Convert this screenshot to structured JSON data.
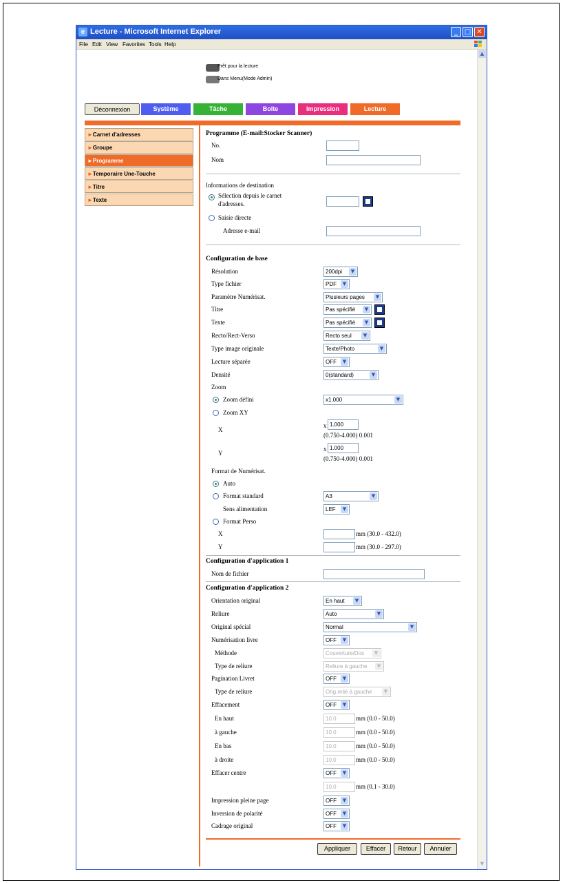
{
  "window": {
    "title": "Lecture - Microsoft Internet Explorer"
  },
  "menu": [
    "File",
    "Edit",
    "View",
    "Favorites",
    "Tools",
    "Help"
  ],
  "status": {
    "ready": "Prêt pour la lecture",
    "admin": "Dans Menu(Mode Admin)"
  },
  "tabs": {
    "logout": "Déconnexion",
    "items": [
      {
        "label": "Système",
        "color": "#4f5df0"
      },
      {
        "label": "Tâche",
        "color": "#36b236"
      },
      {
        "label": "Boîte",
        "color": "#8f45e0"
      },
      {
        "label": "Impression",
        "color": "#ea2d7f"
      },
      {
        "label": "Lecture",
        "color": "#f06a28"
      }
    ]
  },
  "sidebar": {
    "items": [
      {
        "label": "Carnet d'adresses",
        "active": false
      },
      {
        "label": "Groupe",
        "active": false
      },
      {
        "label": "Programme",
        "active": true
      },
      {
        "label": "Temporaire Une-Touche",
        "active": false
      },
      {
        "label": "Titre",
        "active": false
      },
      {
        "label": "Texte",
        "active": false
      }
    ]
  },
  "form": {
    "heading": "Programme (E-mail:Stocker Scanner)",
    "no_label": "No.",
    "name_label": "Nom",
    "dest": {
      "heading": "Informations de destination",
      "from_book": "Sélection depuis le carnet",
      "from_book2": "d'adresses.",
      "direct": "Saisie directe",
      "email_label": "Adresse e-mail"
    },
    "basic": {
      "heading": "Configuration de base",
      "resolution": {
        "label": "Résolution",
        "value": "200dpi"
      },
      "filetype": {
        "label": "Type fichier",
        "value": "PDF"
      },
      "scanparam": {
        "label": "Paramètre Numérisat.",
        "value": "Plusieurs pages"
      },
      "title": {
        "label": "Titre",
        "value": "Pas spécifié"
      },
      "text": {
        "label": "Texte",
        "value": "Pas spécifié"
      },
      "duplex": {
        "label": "Recto/Rect-Verso",
        "value": "Recto seul"
      },
      "imagetype": {
        "label": "Type image originale",
        "value": "Texte/Photo"
      },
      "separate": {
        "label": "Lecture séparée",
        "value": "OFF"
      },
      "density": {
        "label": "Densité",
        "value": "0(standard)"
      },
      "zoom": {
        "label": "Zoom",
        "defined": "Zoom défini",
        "defined_value": "x1.000",
        "xy": "Zoom XY",
        "x_label": "X",
        "y_label": "Y",
        "x_prefix": "x",
        "x_value": "1.000",
        "y_value": "1.000",
        "range": "(0.750-4.000) 0.001"
      },
      "format": {
        "label": "Format de Numérisat.",
        "auto": "Auto",
        "standard": "Format standard",
        "standard_value": "A3",
        "feed_label": "Sens alimentation",
        "feed_value": "LEF",
        "custom": "Format Perso",
        "x_label": "X",
        "y_label": "Y",
        "x_range": "mm (30.0 - 432.0)",
        "y_range": "mm (30.0 - 297.0)"
      }
    },
    "app1": {
      "heading": "Configuration d'application 1",
      "filename_label": "Nom de fichier"
    },
    "app2": {
      "heading": "Configuration d'application 2",
      "orientation": {
        "label": "Orientation original",
        "value": "En haut"
      },
      "binding": {
        "label": "Reliure",
        "value": "Auto"
      },
      "special": {
        "label": "Original spécial",
        "value": "Normal"
      },
      "bookscan": {
        "label": "Numérisation livre",
        "value": "OFF"
      },
      "method": {
        "label": "Méthode",
        "value": "Couverture/Dos"
      },
      "bindtype": {
        "label": "Type de reliure",
        "value": "Reliure à gauche"
      },
      "booklet": {
        "label": "Pagination Livret",
        "value": "OFF"
      },
      "bindtype2": {
        "label": "Type de reliure",
        "value": "Orig.relié à gauche"
      },
      "erase": {
        "label": "Effacement",
        "value": "OFF"
      },
      "top": {
        "label": "En haut",
        "value": "10.0",
        "range": "mm (0.0 - 50.0)"
      },
      "left": {
        "label": "à gauche",
        "value": "10.0",
        "range": "mm (0.0 - 50.0)"
      },
      "bottom": {
        "label": "En bas",
        "value": "10.0",
        "range": "mm (0.0 - 50.0)"
      },
      "right": {
        "label": "à droite",
        "value": "10.0",
        "range": "mm (0.0 - 50.0)"
      },
      "center": {
        "label": "Effacer centre",
        "value": "OFF",
        "field": "10.0",
        "range": "mm (0.1 - 30.0)"
      },
      "fullpage": {
        "label": "Impression pleine page",
        "value": "OFF"
      },
      "polarity": {
        "label": "Inversion de polarité",
        "value": "OFF"
      },
      "framing": {
        "label": "Cadrage original",
        "value": "OFF"
      }
    },
    "buttons": {
      "apply": "Appliquer",
      "clear": "Effacer",
      "back": "Retour",
      "cancel": "Annuler"
    }
  }
}
